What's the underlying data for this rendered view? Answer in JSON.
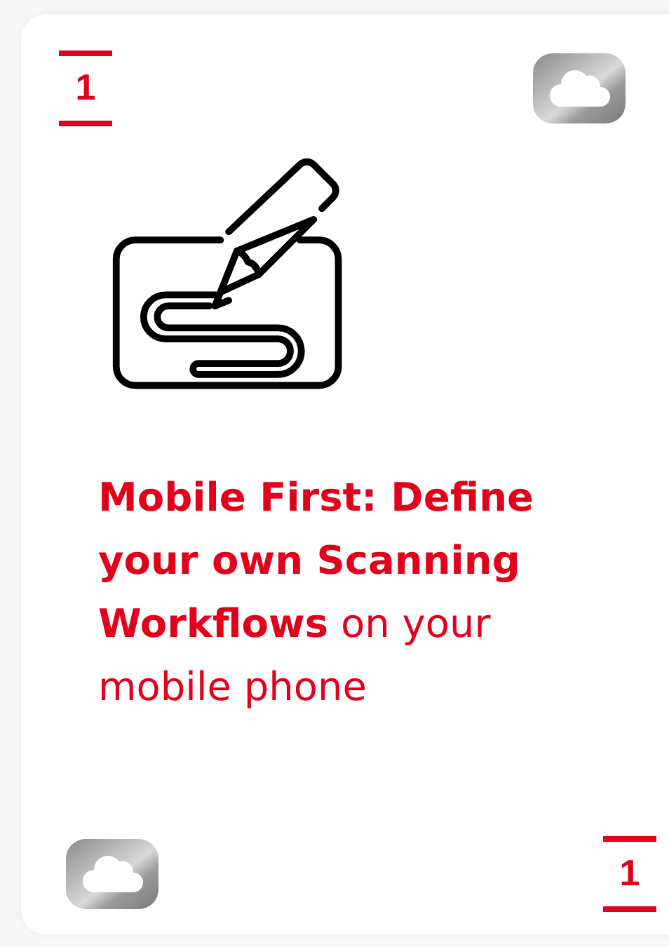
{
  "card": {
    "top_number": "1",
    "heading": "**Mobile First: Define your own Scanning Workflows** on your mobile phone",
    "bottom_number": "1"
  }
}
